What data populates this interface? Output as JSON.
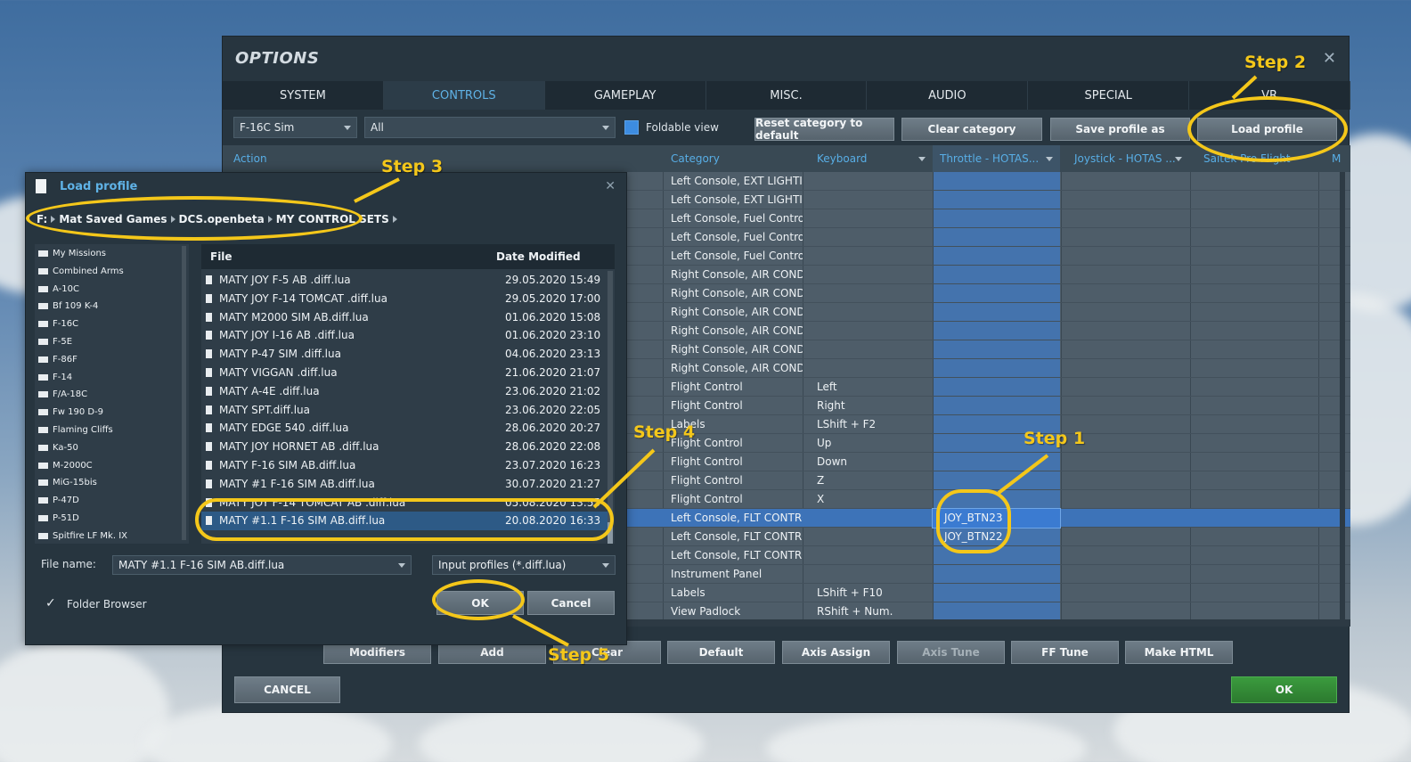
{
  "colors": {
    "accent": "#5fb2e6",
    "highlight": "#f4c71a",
    "throttle_column": "#4473ad",
    "ok_green": "#3b9b3e"
  },
  "options": {
    "title": "OPTIONS",
    "close_icon": "close-icon",
    "tabs": [
      {
        "label": "SYSTEM"
      },
      {
        "label": "CONTROLS"
      },
      {
        "label": "GAMEPLAY"
      },
      {
        "label": "MISC."
      },
      {
        "label": "AUDIO"
      },
      {
        "label": "SPECIAL"
      },
      {
        "label": "VR"
      }
    ],
    "active_tab": "CONTROLS",
    "aircraft_select": "F-16C Sim",
    "category_select": "All",
    "foldable_label": "Foldable view",
    "foldable_checked": true,
    "buttons": {
      "reset": "Reset category to default",
      "clear": "Clear category",
      "save": "Save profile as",
      "load": "Load profile"
    },
    "columns": {
      "action": "Action",
      "category": "Category",
      "keyboard": "Keyboard",
      "throttle": "Throttle - HOTAS...",
      "joystick": "Joystick - HOTAS ...",
      "saitek": "Saitek Pro Flight",
      "extra": "M"
    },
    "rows": [
      {
        "category": "Left Console, EXT LIGHTIN",
        "keyboard": "",
        "throttle": ""
      },
      {
        "category": "Left Console, EXT LIGHTIN",
        "keyboard": "",
        "throttle": ""
      },
      {
        "category": "Left Console, Fuel Control",
        "keyboard": "",
        "throttle": ""
      },
      {
        "category": "Left Console, Fuel Control",
        "keyboard": "",
        "throttle": ""
      },
      {
        "category": "Left Console, Fuel Control",
        "keyboard": "",
        "throttle": ""
      },
      {
        "category": "Right Console, AIR COND",
        "keyboard": "",
        "throttle": ""
      },
      {
        "category": "Right Console, AIR COND",
        "keyboard": "",
        "throttle": ""
      },
      {
        "category": "Right Console, AIR COND",
        "keyboard": "",
        "throttle": ""
      },
      {
        "category": "Right Console, AIR COND",
        "keyboard": "",
        "throttle": ""
      },
      {
        "category": "Right Console, AIR COND",
        "keyboard": "",
        "throttle": ""
      },
      {
        "category": "Right Console, AIR COND",
        "keyboard": "",
        "throttle": ""
      },
      {
        "category": "Flight Control",
        "keyboard": "Left",
        "throttle": ""
      },
      {
        "category": "Flight Control",
        "keyboard": "Right",
        "throttle": ""
      },
      {
        "category": "Labels",
        "keyboard": "LShift + F2",
        "throttle": ""
      },
      {
        "category": "Flight Control",
        "keyboard": "Up",
        "throttle": ""
      },
      {
        "category": "Flight Control",
        "keyboard": "Down",
        "throttle": ""
      },
      {
        "category": "Flight Control",
        "keyboard": "Z",
        "throttle": ""
      },
      {
        "category": "Flight Control",
        "keyboard": "X",
        "throttle": ""
      },
      {
        "category": "Left Console, FLT CONTRO",
        "keyboard": "",
        "throttle": "JOY_BTN23"
      },
      {
        "category": "Left Console, FLT CONTRO",
        "keyboard": "",
        "throttle": "JOY_BTN22"
      },
      {
        "category": "Left Console, FLT CONTRO",
        "keyboard": "",
        "throttle": ""
      },
      {
        "category": "Instrument Panel",
        "keyboard": "",
        "throttle": ""
      },
      {
        "category": "Labels",
        "keyboard": "LShift + F10",
        "throttle": ""
      },
      {
        "category": "View Padlock",
        "keyboard": "RShift + Num.",
        "throttle": ""
      }
    ],
    "selected_row_index": 18,
    "bottom_buttons": {
      "modifiers": "Modifiers",
      "add": "Add",
      "clear": "Clear",
      "default": "Default",
      "axis_assign": "Axis Assign",
      "axis_tune": "Axis Tune",
      "ff_tune": "FF Tune",
      "make_html": "Make HTML"
    },
    "cancel": "CANCEL",
    "ok": "OK"
  },
  "dialog": {
    "title": "Load profile",
    "breadcrumb": [
      "F:",
      "Mat Saved Games",
      "DCS.openbeta",
      "MY CONTROL SETS"
    ],
    "folders": [
      "My Missions",
      "Combined Arms",
      "A-10C",
      "Bf 109 K-4",
      "F-16C",
      "F-5E",
      "F-86F",
      "F-14",
      "F/A-18C",
      "Fw 190 D-9",
      "Flaming Cliffs",
      "Ka-50",
      "M-2000C",
      "MiG-15bis",
      "P-47D",
      "P-51D",
      "Spitfire LF Mk. IX"
    ],
    "file_header": "File",
    "date_header": "Date Modified",
    "files": [
      {
        "name": "MATY JOY F-5 AB .diff.lua",
        "date": "29.05.2020 15:49"
      },
      {
        "name": "MATY JOY F-14 TOMCAT .diff.lua",
        "date": "29.05.2020 17:00"
      },
      {
        "name": "MATY M2000 SIM AB.diff.lua",
        "date": "01.06.2020 15:08"
      },
      {
        "name": "MATY JOY I-16 AB .diff.lua",
        "date": "01.06.2020 23:10"
      },
      {
        "name": "MATY P-47 SIM .diff.lua",
        "date": "04.06.2020 23:13"
      },
      {
        "name": "MATY VIGGAN  .diff.lua",
        "date": "21.06.2020 21:07"
      },
      {
        "name": "MATY A-4E  .diff.lua",
        "date": "23.06.2020 21:02"
      },
      {
        "name": "MATY SPT.diff.lua",
        "date": "23.06.2020 22:05"
      },
      {
        "name": "MATY EDGE 540 .diff.lua",
        "date": "28.06.2020 20:27"
      },
      {
        "name": "MATY JOY  HORNET AB .diff.lua",
        "date": "28.06.2020 22:08"
      },
      {
        "name": "MATY F-16 SIM AB.diff.lua",
        "date": "23.07.2020 16:23"
      },
      {
        "name": "MATY #1  F-16 SIM AB.diff.lua",
        "date": "30.07.2020 21:27"
      },
      {
        "name": "MATY JOY F-14 TOMCAT AB .diff.lua",
        "date": "05.08.2020 13:55"
      },
      {
        "name": "MATY #1.1  F-16 SIM AB.diff.lua",
        "date": "20.08.2020 16:33"
      }
    ],
    "selected_file_index": 13,
    "file_name_label": "File name:",
    "file_name_value": "MATY #1.1  F-16 SIM AB.diff.lua",
    "filter_value": "Input profiles (*.diff.lua)",
    "folder_browser_label": "Folder Browser",
    "folder_browser_checked": true,
    "ok": "OK",
    "cancel": "Cancel"
  },
  "annotations": {
    "step1": "Step 1",
    "step2": "Step 2",
    "step3": "Step 3",
    "step4": "Step 4",
    "step5": "Step 5"
  }
}
